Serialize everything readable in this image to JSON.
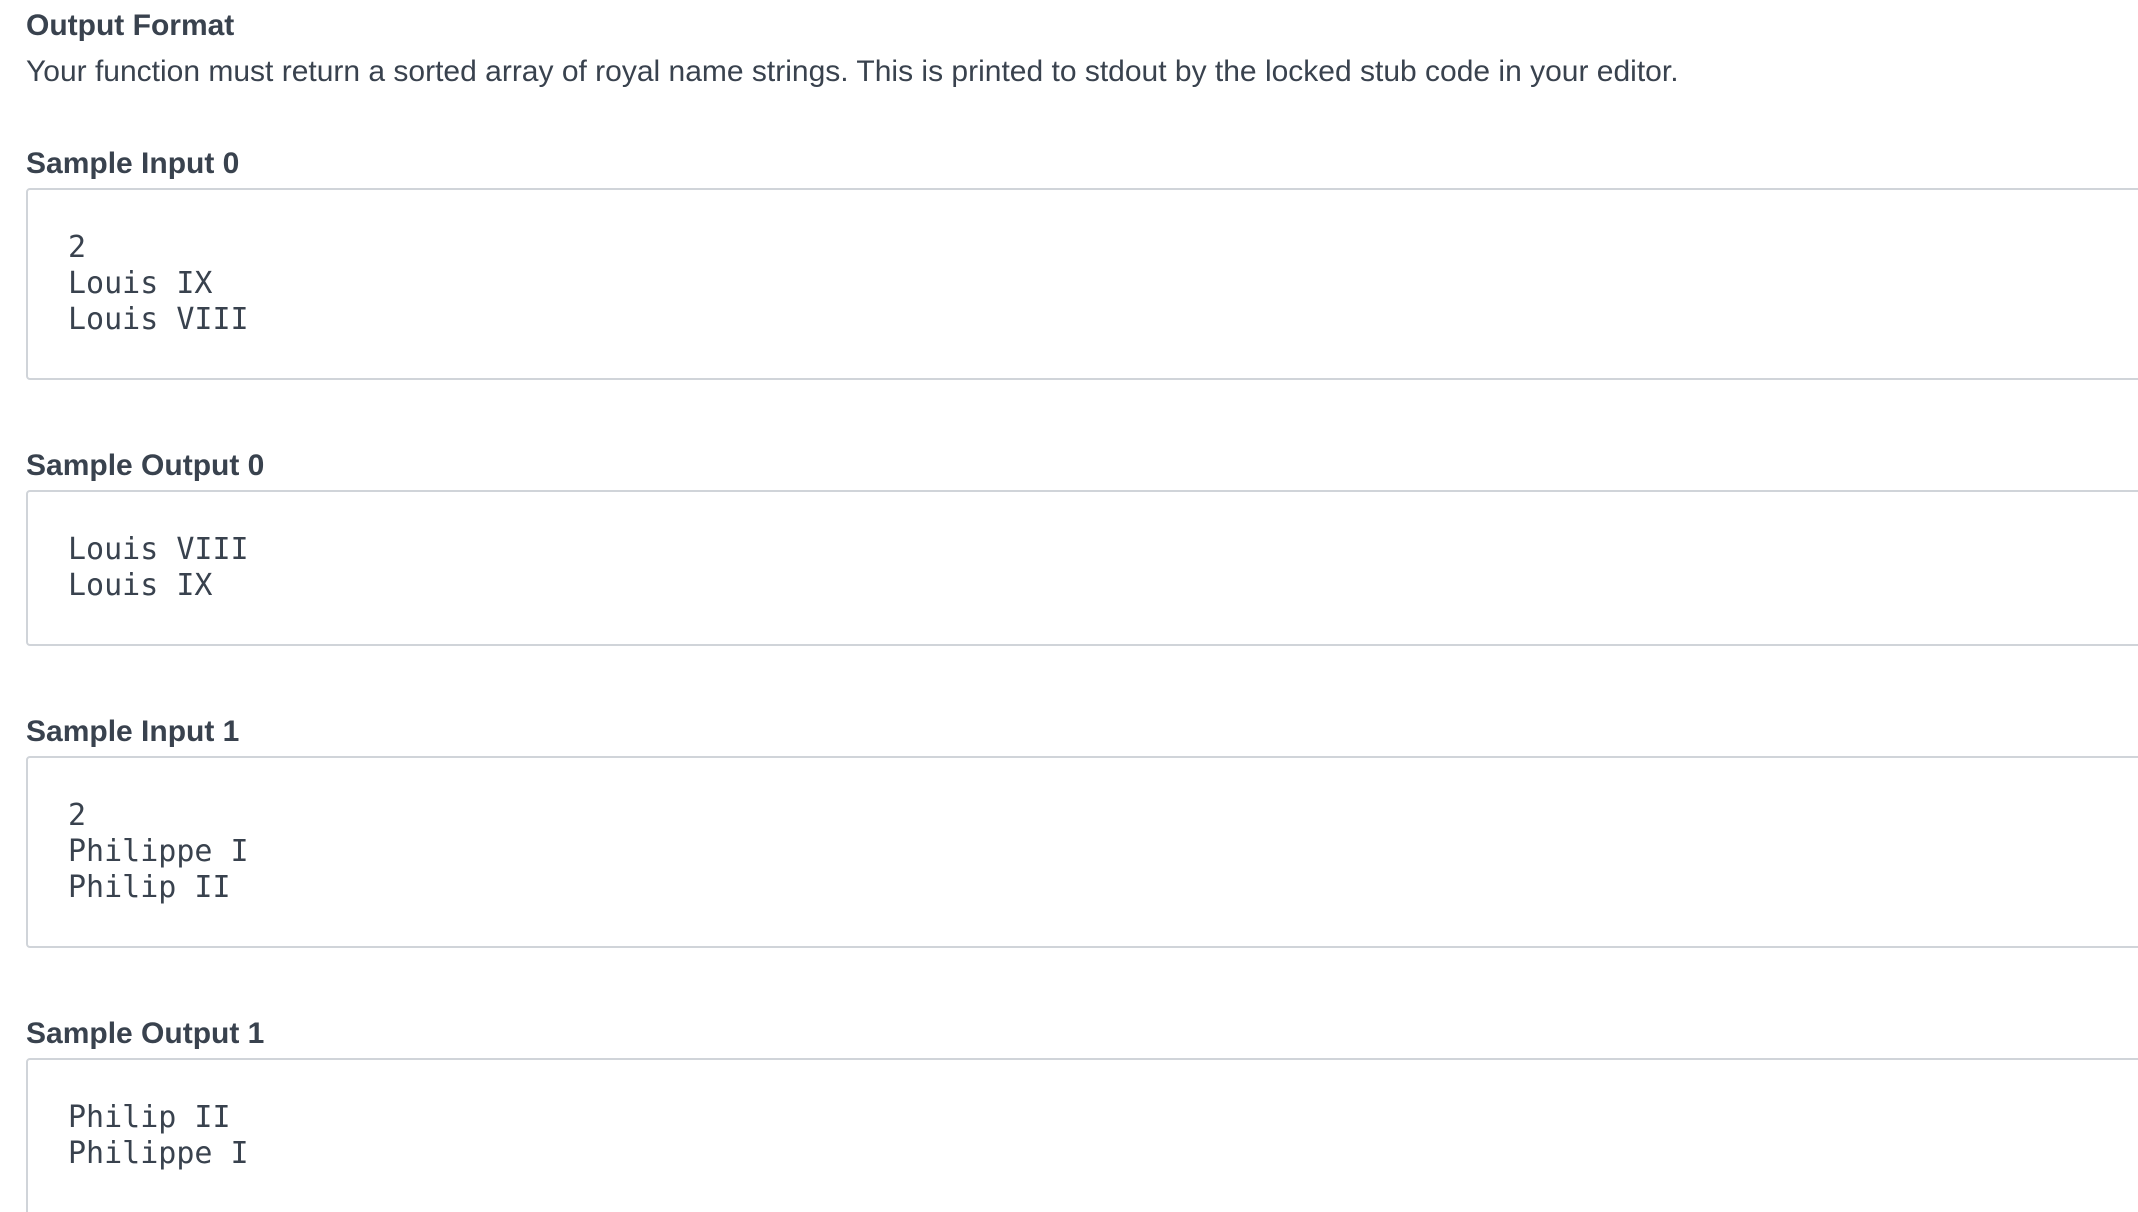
{
  "output_format": {
    "heading": "Output Format",
    "text": "Your function must return a sorted array of royal name strings. This is printed to stdout by the locked stub code in your editor."
  },
  "samples": [
    {
      "heading": "Sample Input 0",
      "lines": [
        "2",
        "Louis IX",
        "Louis VIII"
      ]
    },
    {
      "heading": "Sample Output 0",
      "lines": [
        "Louis VIII",
        "Louis IX"
      ]
    },
    {
      "heading": "Sample Input 1",
      "lines": [
        "2",
        "Philippe I",
        "Philip II"
      ]
    },
    {
      "heading": "Sample Output 1",
      "lines": [
        "Philip II",
        "Philippe I"
      ]
    }
  ]
}
